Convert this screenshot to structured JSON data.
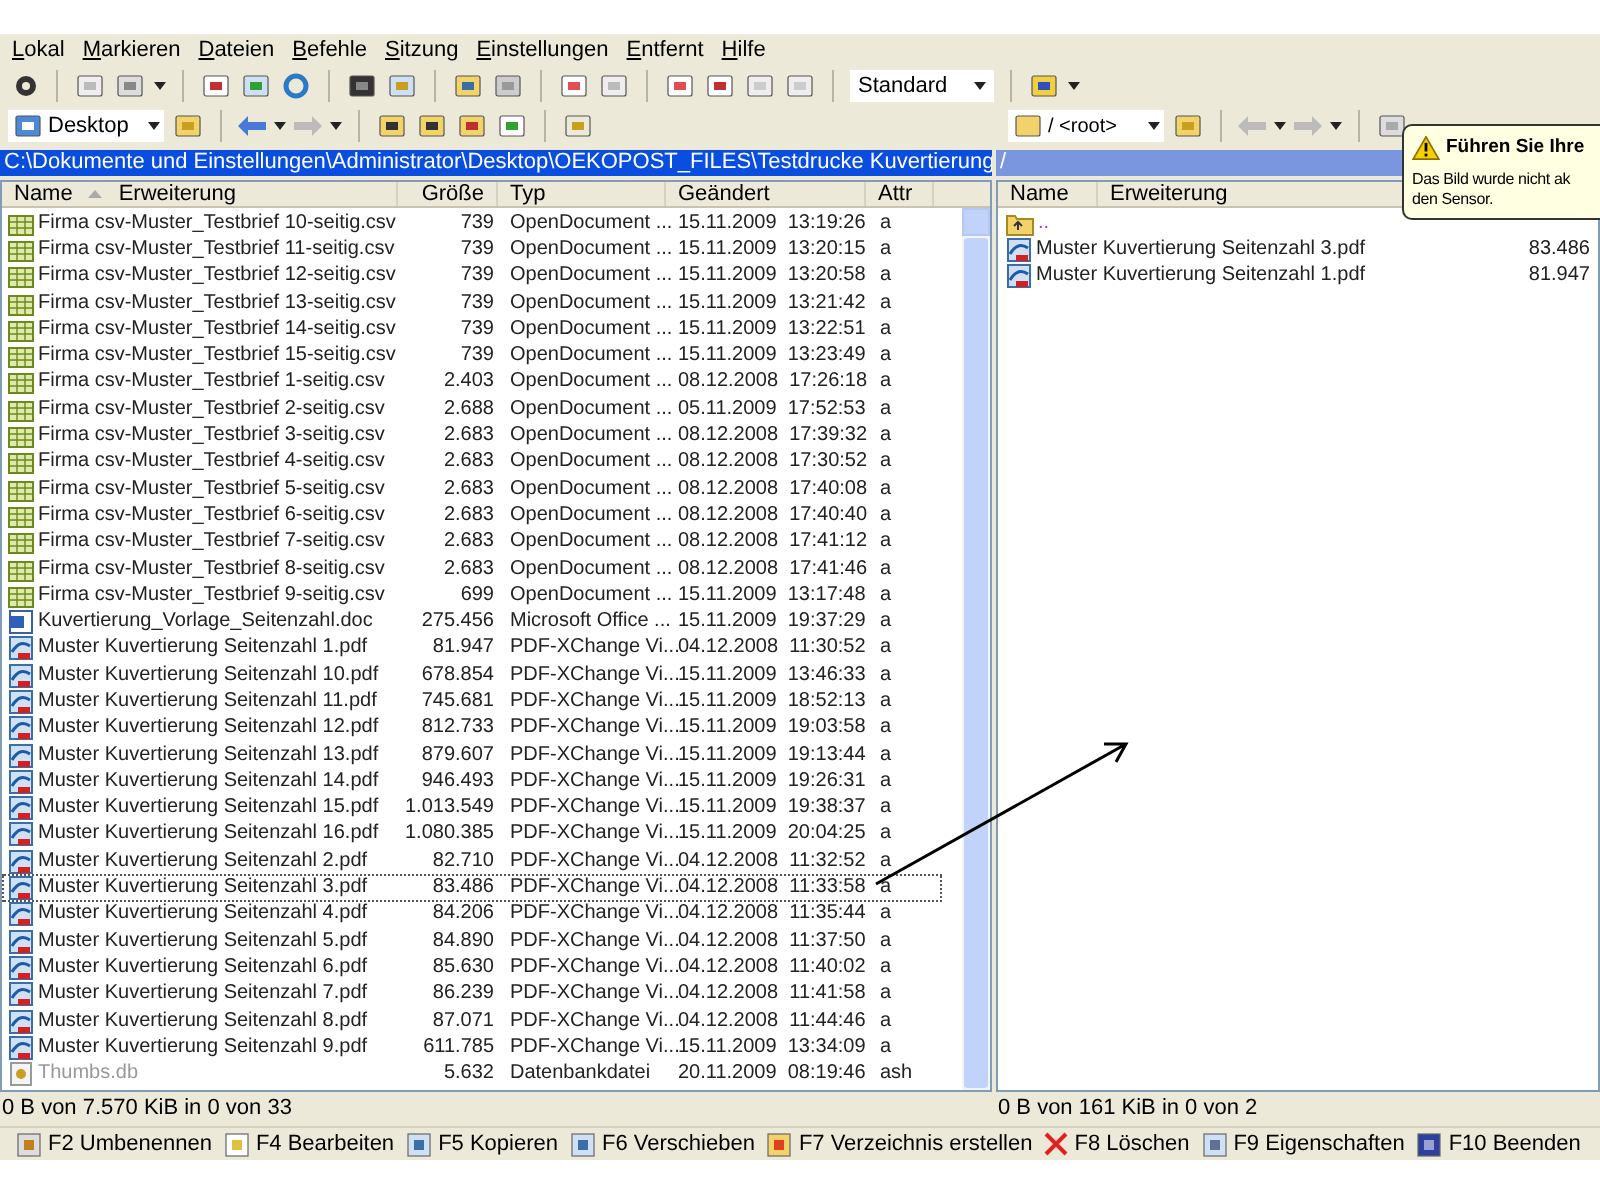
{
  "menu": [
    "Lokal",
    "Markieren",
    "Dateien",
    "Befehle",
    "Sitzung",
    "Einstellungen",
    "Entfernt",
    "Hilfe"
  ],
  "toolbar": {
    "profile": "Standard"
  },
  "left": {
    "location": "Desktop",
    "path": "C:\\Dokumente und Einstellungen\\Administrator\\Desktop\\OEKOPOST_FILES\\Testdrucke Kuvertierung",
    "active": true,
    "columns": [
      "Name",
      "Erweiterung",
      "Größe",
      "Typ",
      "Geändert",
      "Attr"
    ],
    "rows": [
      {
        "kind": "csv",
        "name": "Firma csv-Muster_Testbrief 10-seitig.csv",
        "size": "739",
        "type": "OpenDocument ...",
        "date": "15.11.2009",
        "time": "13:19:26",
        "attr": "a",
        "focused": false,
        "hidden": false
      },
      {
        "kind": "csv",
        "name": "Firma csv-Muster_Testbrief 11-seitig.csv",
        "size": "739",
        "type": "OpenDocument ...",
        "date": "15.11.2009",
        "time": "13:20:15",
        "attr": "a",
        "focused": false,
        "hidden": false
      },
      {
        "kind": "csv",
        "name": "Firma csv-Muster_Testbrief 12-seitig.csv",
        "size": "739",
        "type": "OpenDocument ...",
        "date": "15.11.2009",
        "time": "13:20:58",
        "attr": "a",
        "focused": false,
        "hidden": false
      },
      {
        "kind": "csv",
        "name": "Firma csv-Muster_Testbrief 13-seitig.csv",
        "size": "739",
        "type": "OpenDocument ...",
        "date": "15.11.2009",
        "time": "13:21:42",
        "attr": "a",
        "focused": false,
        "hidden": false
      },
      {
        "kind": "csv",
        "name": "Firma csv-Muster_Testbrief 14-seitig.csv",
        "size": "739",
        "type": "OpenDocument ...",
        "date": "15.11.2009",
        "time": "13:22:51",
        "attr": "a",
        "focused": false,
        "hidden": false
      },
      {
        "kind": "csv",
        "name": "Firma csv-Muster_Testbrief 15-seitig.csv",
        "size": "739",
        "type": "OpenDocument ...",
        "date": "15.11.2009",
        "time": "13:23:49",
        "attr": "a",
        "focused": false,
        "hidden": false
      },
      {
        "kind": "csv",
        "name": "Firma csv-Muster_Testbrief 1-seitig.csv",
        "size": "2.403",
        "type": "OpenDocument ...",
        "date": "08.12.2008",
        "time": "17:26:18",
        "attr": "a",
        "focused": false,
        "hidden": false
      },
      {
        "kind": "csv",
        "name": "Firma csv-Muster_Testbrief 2-seitig.csv",
        "size": "2.688",
        "type": "OpenDocument ...",
        "date": "05.11.2009",
        "time": "17:52:53",
        "attr": "a",
        "focused": false,
        "hidden": false
      },
      {
        "kind": "csv",
        "name": "Firma csv-Muster_Testbrief 3-seitig.csv",
        "size": "2.683",
        "type": "OpenDocument ...",
        "date": "08.12.2008",
        "time": "17:39:32",
        "attr": "a",
        "focused": false,
        "hidden": false
      },
      {
        "kind": "csv",
        "name": "Firma csv-Muster_Testbrief 4-seitig.csv",
        "size": "2.683",
        "type": "OpenDocument ...",
        "date": "08.12.2008",
        "time": "17:30:52",
        "attr": "a",
        "focused": false,
        "hidden": false
      },
      {
        "kind": "csv",
        "name": "Firma csv-Muster_Testbrief 5-seitig.csv",
        "size": "2.683",
        "type": "OpenDocument ...",
        "date": "08.12.2008",
        "time": "17:40:08",
        "attr": "a",
        "focused": false,
        "hidden": false
      },
      {
        "kind": "csv",
        "name": "Firma csv-Muster_Testbrief 6-seitig.csv",
        "size": "2.683",
        "type": "OpenDocument ...",
        "date": "08.12.2008",
        "time": "17:40:40",
        "attr": "a",
        "focused": false,
        "hidden": false
      },
      {
        "kind": "csv",
        "name": "Firma csv-Muster_Testbrief 7-seitig.csv",
        "size": "2.683",
        "type": "OpenDocument ...",
        "date": "08.12.2008",
        "time": "17:41:12",
        "attr": "a",
        "focused": false,
        "hidden": false
      },
      {
        "kind": "csv",
        "name": "Firma csv-Muster_Testbrief 8-seitig.csv",
        "size": "2.683",
        "type": "OpenDocument ...",
        "date": "08.12.2008",
        "time": "17:41:46",
        "attr": "a",
        "focused": false,
        "hidden": false
      },
      {
        "kind": "csv",
        "name": "Firma csv-Muster_Testbrief 9-seitig.csv",
        "size": "699",
        "type": "OpenDocument ...",
        "date": "15.11.2009",
        "time": "13:17:48",
        "attr": "a",
        "focused": false,
        "hidden": false
      },
      {
        "kind": "doc",
        "name": "Kuvertierung_Vorlage_Seitenzahl.doc",
        "size": "275.456",
        "type": "Microsoft Office ...",
        "date": "15.11.2009",
        "time": "19:37:29",
        "attr": "a",
        "focused": false,
        "hidden": false
      },
      {
        "kind": "pdf",
        "name": "Muster Kuvertierung Seitenzahl 1.pdf",
        "size": "81.947",
        "type": "PDF-XChange Vi...",
        "date": "04.12.2008",
        "time": "11:30:52",
        "attr": "a",
        "focused": false,
        "hidden": false
      },
      {
        "kind": "pdf",
        "name": "Muster Kuvertierung Seitenzahl 10.pdf",
        "size": "678.854",
        "type": "PDF-XChange Vi...",
        "date": "15.11.2009",
        "time": "13:46:33",
        "attr": "a",
        "focused": false,
        "hidden": false
      },
      {
        "kind": "pdf",
        "name": "Muster Kuvertierung Seitenzahl 11.pdf",
        "size": "745.681",
        "type": "PDF-XChange Vi...",
        "date": "15.11.2009",
        "time": "18:52:13",
        "attr": "a",
        "focused": false,
        "hidden": false
      },
      {
        "kind": "pdf",
        "name": "Muster Kuvertierung Seitenzahl 12.pdf",
        "size": "812.733",
        "type": "PDF-XChange Vi...",
        "date": "15.11.2009",
        "time": "19:03:58",
        "attr": "a",
        "focused": false,
        "hidden": false
      },
      {
        "kind": "pdf",
        "name": "Muster Kuvertierung Seitenzahl 13.pdf",
        "size": "879.607",
        "type": "PDF-XChange Vi...",
        "date": "15.11.2009",
        "time": "19:13:44",
        "attr": "a",
        "focused": false,
        "hidden": false
      },
      {
        "kind": "pdf",
        "name": "Muster Kuvertierung Seitenzahl 14.pdf",
        "size": "946.493",
        "type": "PDF-XChange Vi...",
        "date": "15.11.2009",
        "time": "19:26:31",
        "attr": "a",
        "focused": false,
        "hidden": false
      },
      {
        "kind": "pdf",
        "name": "Muster Kuvertierung Seitenzahl 15.pdf",
        "size": "1.013.549",
        "type": "PDF-XChange Vi...",
        "date": "15.11.2009",
        "time": "19:38:37",
        "attr": "a",
        "focused": false,
        "hidden": false
      },
      {
        "kind": "pdf",
        "name": "Muster Kuvertierung Seitenzahl 16.pdf",
        "size": "1.080.385",
        "type": "PDF-XChange Vi...",
        "date": "15.11.2009",
        "time": "20:04:25",
        "attr": "a",
        "focused": false,
        "hidden": false
      },
      {
        "kind": "pdf",
        "name": "Muster Kuvertierung Seitenzahl 2.pdf",
        "size": "82.710",
        "type": "PDF-XChange Vi...",
        "date": "04.12.2008",
        "time": "11:32:52",
        "attr": "a",
        "focused": false,
        "hidden": false
      },
      {
        "kind": "pdf",
        "name": "Muster Kuvertierung Seitenzahl 3.pdf",
        "size": "83.486",
        "type": "PDF-XChange Vi...",
        "date": "04.12.2008",
        "time": "11:33:58",
        "attr": "a",
        "focused": true,
        "hidden": false
      },
      {
        "kind": "pdf",
        "name": "Muster Kuvertierung Seitenzahl 4.pdf",
        "size": "84.206",
        "type": "PDF-XChange Vi...",
        "date": "04.12.2008",
        "time": "11:35:44",
        "attr": "a",
        "focused": false,
        "hidden": false
      },
      {
        "kind": "pdf",
        "name": "Muster Kuvertierung Seitenzahl 5.pdf",
        "size": "84.890",
        "type": "PDF-XChange Vi...",
        "date": "04.12.2008",
        "time": "11:37:50",
        "attr": "a",
        "focused": false,
        "hidden": false
      },
      {
        "kind": "pdf",
        "name": "Muster Kuvertierung Seitenzahl 6.pdf",
        "size": "85.630",
        "type": "PDF-XChange Vi...",
        "date": "04.12.2008",
        "time": "11:40:02",
        "attr": "a",
        "focused": false,
        "hidden": false
      },
      {
        "kind": "pdf",
        "name": "Muster Kuvertierung Seitenzahl 7.pdf",
        "size": "86.239",
        "type": "PDF-XChange Vi...",
        "date": "04.12.2008",
        "time": "11:41:58",
        "attr": "a",
        "focused": false,
        "hidden": false
      },
      {
        "kind": "pdf",
        "name": "Muster Kuvertierung Seitenzahl 8.pdf",
        "size": "87.071",
        "type": "PDF-XChange Vi...",
        "date": "04.12.2008",
        "time": "11:44:46",
        "attr": "a",
        "focused": false,
        "hidden": false
      },
      {
        "kind": "pdf",
        "name": "Muster Kuvertierung Seitenzahl 9.pdf",
        "size": "611.785",
        "type": "PDF-XChange Vi...",
        "date": "15.11.2009",
        "time": "13:34:09",
        "attr": "a",
        "focused": false,
        "hidden": false
      },
      {
        "kind": "db",
        "name": "Thumbs.db",
        "size": "5.632",
        "type": "Datenbankdatei",
        "date": "20.11.2009",
        "time": "08:19:46",
        "attr": "ash",
        "focused": false,
        "hidden": true
      }
    ],
    "status": "0 B von 7.570 KiB in 0 von 33"
  },
  "right": {
    "location": "/ <root>",
    "path": "/",
    "active": false,
    "columns": [
      "Name",
      "Erweiterung"
    ],
    "rows": [
      {
        "kind": "parent",
        "name": "..",
        "size": ""
      },
      {
        "kind": "pdf",
        "name": "Muster Kuvertierung Seitenzahl 3.pdf",
        "size": "83.486"
      },
      {
        "kind": "pdf",
        "name": "Muster Kuvertierung Seitenzahl 1.pdf",
        "size": "81.947"
      }
    ],
    "status": "0 B von 161 KiB in 0 von 2"
  },
  "balloon": {
    "title": "Führen Sie Ihre",
    "lines": [
      "Das Bild wurde nicht ak",
      "den Sensor."
    ]
  },
  "function_keys": [
    "F2 Umbenennen",
    "F4 Bearbeiten",
    "F5 Kopieren",
    "F6 Verschieben",
    "F7 Verzeichnis erstellen",
    "F8 Löschen",
    "F9 Eigenschaften",
    "F10 Beenden"
  ]
}
